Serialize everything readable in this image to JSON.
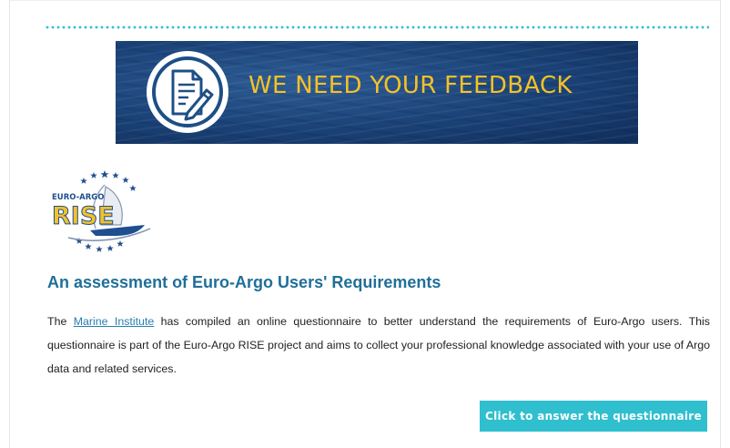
{
  "banner": {
    "title": "WE NEED YOUR FEEDBACK",
    "icon": "document-pen-icon",
    "title_color": "#f6c125"
  },
  "logo": {
    "text_top": "EURO-ARGO",
    "text_main": "RISE",
    "icon": "ship-with-stars-logo"
  },
  "content": {
    "heading": "An assessment of Euro-Argo Users' Requirements",
    "para_prefix": "The ",
    "link_text": "Marine Institute",
    "para_rest": " has compiled an online questionnaire to better understand the requirements of Euro-Argo users.  This questionnaire is part of the Euro-Argo RISE project and aims to collect your professional knowledge associated with your use of Argo data and related services."
  },
  "cta": {
    "label": "Click to answer the questionnaire"
  },
  "colors": {
    "accent": "#2fbfce",
    "heading": "#1f6f99",
    "link": "#2a7fae",
    "banner_bg": "#1d467c"
  }
}
